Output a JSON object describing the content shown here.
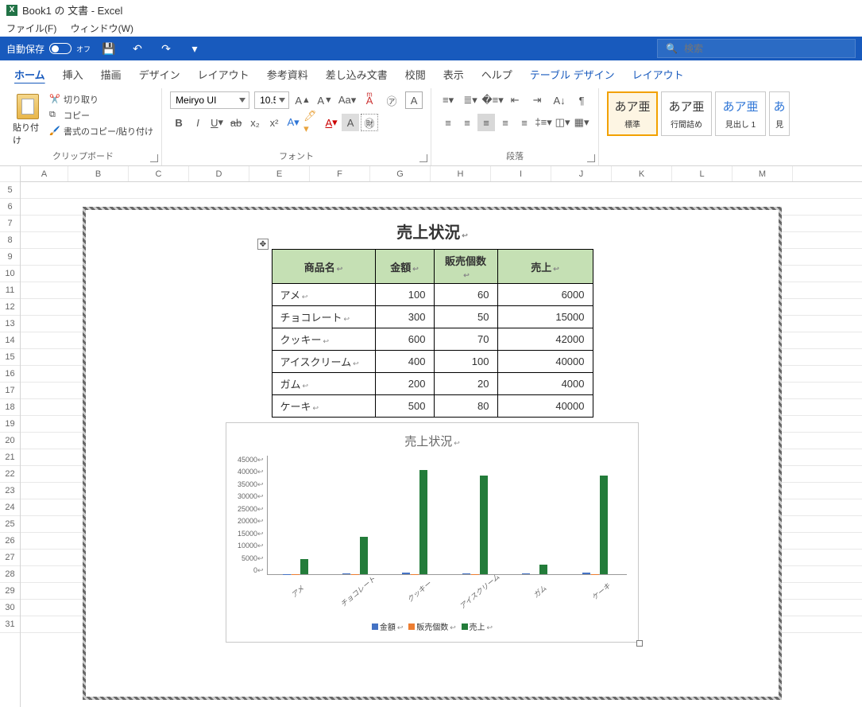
{
  "title": "Book1 の 文書 - Excel",
  "menus": {
    "file": "ファイル(F)",
    "window": "ウィンドウ(W)"
  },
  "autosave": {
    "label": "自動保存",
    "state": "オフ"
  },
  "search": {
    "placeholder": "検索"
  },
  "tabs": {
    "home": "ホーム",
    "insert": "挿入",
    "draw": "描画",
    "design": "デザイン",
    "layout": "レイアウト",
    "refs": "参考資料",
    "mail": "差し込み文書",
    "review": "校閲",
    "view": "表示",
    "help": "ヘルプ",
    "tbldesign": "テーブル デザイン",
    "tbllayout": "レイアウト"
  },
  "clip": {
    "paste": "貼り付け",
    "cut": "切り取り",
    "copy": "コピー",
    "painter": "書式のコピー/貼り付け",
    "label": "クリップボード"
  },
  "font": {
    "name": "Meiryo UI",
    "size": "10.5",
    "label": "フォント"
  },
  "para": {
    "label": "段落"
  },
  "styles": {
    "s1": {
      "sample": "あア亜",
      "name": "標準"
    },
    "s2": {
      "sample": "あア亜",
      "name": "行間詰め"
    },
    "s3": {
      "sample": "あア亜",
      "name": "見出し 1"
    },
    "s4": {
      "sample": "あ",
      "name": "見"
    }
  },
  "columns": [
    "A",
    "B",
    "C",
    "D",
    "E",
    "F",
    "G",
    "H",
    "I",
    "J",
    "K",
    "L",
    "M"
  ],
  "rows": [
    "5",
    "6",
    "7",
    "8",
    "9",
    "10",
    "11",
    "12",
    "13",
    "14",
    "15",
    "16",
    "17",
    "18",
    "19",
    "20",
    "21",
    "22",
    "23",
    "24",
    "25",
    "26",
    "27",
    "28",
    "29",
    "30",
    "31"
  ],
  "doc": {
    "title": "売上状況"
  },
  "table": {
    "headers": [
      "商品名",
      "金額",
      "販売個数",
      "売上"
    ],
    "rows": [
      {
        "n": "アメ",
        "a": "100",
        "q": "60",
        "s": "6000"
      },
      {
        "n": "チョコレート",
        "a": "300",
        "q": "50",
        "s": "15000"
      },
      {
        "n": "クッキー",
        "a": "600",
        "q": "70",
        "s": "42000"
      },
      {
        "n": "アイスクリーム",
        "a": "400",
        "q": "100",
        "s": "40000"
      },
      {
        "n": "ガム",
        "a": "200",
        "q": "20",
        "s": "4000"
      },
      {
        "n": "ケーキ",
        "a": "500",
        "q": "80",
        "s": "40000"
      }
    ]
  },
  "chart_data": {
    "type": "bar",
    "title": "売上状況",
    "categories": [
      "アメ",
      "チョコレート",
      "クッキー",
      "アイスクリーム",
      "ガム",
      "ケーキ"
    ],
    "series": [
      {
        "name": "金額",
        "values": [
          100,
          300,
          600,
          400,
          200,
          500
        ]
      },
      {
        "name": "販売個数",
        "values": [
          60,
          50,
          70,
          100,
          20,
          80
        ]
      },
      {
        "name": "売上",
        "values": [
          6000,
          15000,
          42000,
          40000,
          4000,
          40000
        ]
      }
    ],
    "ylim": [
      0,
      45000
    ],
    "yticks": [
      "45000",
      "40000",
      "35000",
      "30000",
      "25000",
      "20000",
      "15000",
      "10000",
      "5000",
      "0"
    ]
  }
}
